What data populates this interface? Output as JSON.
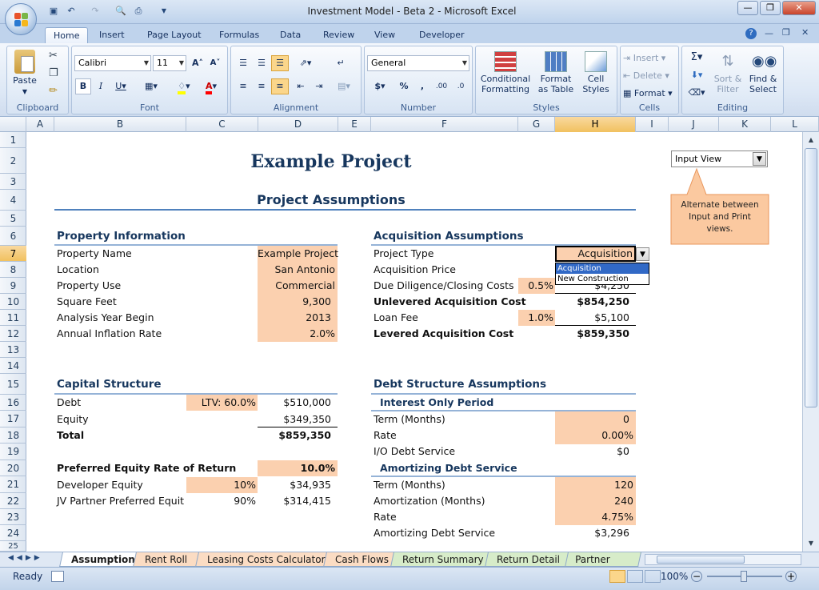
{
  "window": {
    "title": "Investment Model - Beta 2 - Microsoft Excel"
  },
  "ribbon_tabs": [
    "Home",
    "Insert",
    "Page Layout",
    "Formulas",
    "Data",
    "Review",
    "View",
    "Developer"
  ],
  "ribbon": {
    "clipboard": {
      "label": "Clipboard",
      "paste": "Paste"
    },
    "font": {
      "label": "Font",
      "name": "Calibri",
      "size": "11"
    },
    "alignment": {
      "label": "Alignment"
    },
    "number": {
      "label": "Number",
      "format": "General"
    },
    "styles": {
      "label": "Styles",
      "conditional": "Conditional\nFormatting",
      "format_table": "Format\nas Table",
      "cell_styles": "Cell\nStyles"
    },
    "cells": {
      "label": "Cells",
      "insert": "Insert",
      "delete": "Delete",
      "format": "Format"
    },
    "editing": {
      "label": "Editing",
      "sort": "Sort &\nFilter",
      "find": "Find &\nSelect"
    }
  },
  "columns": [
    "A",
    "B",
    "C",
    "D",
    "E",
    "F",
    "G",
    "H",
    "I",
    "J",
    "K",
    "L"
  ],
  "rows": [
    "1",
    "2",
    "3",
    "4",
    "5",
    "6",
    "7",
    "8",
    "9",
    "10",
    "11",
    "12",
    "13",
    "14",
    "15",
    "16",
    "17",
    "18",
    "19",
    "20",
    "21",
    "22",
    "23",
    "24",
    "25"
  ],
  "sheet": {
    "title": "Example Project",
    "subtitle": "Project Assumptions",
    "view_select": "Input View",
    "callout": "Alternate between Input and Print views.",
    "property": {
      "header": "Property Information",
      "rows": [
        {
          "label": "Property Name",
          "value": "Example Project"
        },
        {
          "label": "Location",
          "value": "San Antonio"
        },
        {
          "label": "Property Use",
          "value": "Commercial"
        },
        {
          "label": "Square Feet",
          "value": "9,300"
        },
        {
          "label": "Analysis Year Begin",
          "value": "2013"
        },
        {
          "label": "Annual Inflation Rate",
          "value": "2.0%"
        }
      ]
    },
    "acquisition": {
      "header": "Acquisition Assumptions",
      "project_type_label": "Project Type",
      "project_type_value": "Acquisition",
      "dropdown_options": [
        "Acquisition",
        "New Construction"
      ],
      "price_label": "Acquisition Price",
      "dd_label": "Due Diligence/Closing Costs",
      "dd_pct": "0.5%",
      "dd_value": "$4,250",
      "unlev_label": "Unlevered Acquisition Cost",
      "unlev_value": "$854,250",
      "loan_label": "Loan Fee",
      "loan_pct": "1.0%",
      "loan_value": "$5,100",
      "lev_label": "Levered Acquisition Cost",
      "lev_value": "$859,350"
    },
    "capital": {
      "header": "Capital Structure",
      "debt_label": "Debt",
      "ltv": "LTV:  60.0%",
      "debt_value": "$510,000",
      "equity_label": "Equity",
      "equity_value": "$349,350",
      "total_label": "Total",
      "total_value": "$859,350",
      "pref_label": "Preferred Equity Rate of Return",
      "pref_value": "10.0%",
      "dev_label": "Developer Equity",
      "dev_pct": "10%",
      "dev_value": "$34,935",
      "jv_label": "JV Partner Preferred Equit",
      "jv_pct": "90%",
      "jv_value": "$314,415"
    },
    "debt": {
      "header": "Debt Structure Assumptions",
      "io_header": "Interest Only Period",
      "io_term_label": "Term (Months)",
      "io_term": "0",
      "io_rate_label": "Rate",
      "io_rate": "0.00%",
      "io_service_label": "I/O Debt Service",
      "io_service": "$0",
      "am_header": "Amortizing Debt Service",
      "am_term_label": "Term (Months)",
      "am_term": "120",
      "am_amort_label": "Amortization (Months)",
      "am_amort": "240",
      "am_rate_label": "Rate",
      "am_rate": "4.75%",
      "am_service_label": "Amortizing Debt Service",
      "am_service": "$3,296"
    }
  },
  "sheet_tabs": [
    "Assumptions",
    "Rent Roll",
    "Leasing Costs Calculator",
    "Cash Flows",
    "Return Summary",
    "Return Detail",
    "Partner Retur"
  ],
  "status": {
    "ready": "Ready",
    "zoom": "100%"
  },
  "colors": {
    "input": "#fbd0af",
    "header": "#17375e",
    "rule": "#95b3d7",
    "selected": "#f1c15f"
  }
}
